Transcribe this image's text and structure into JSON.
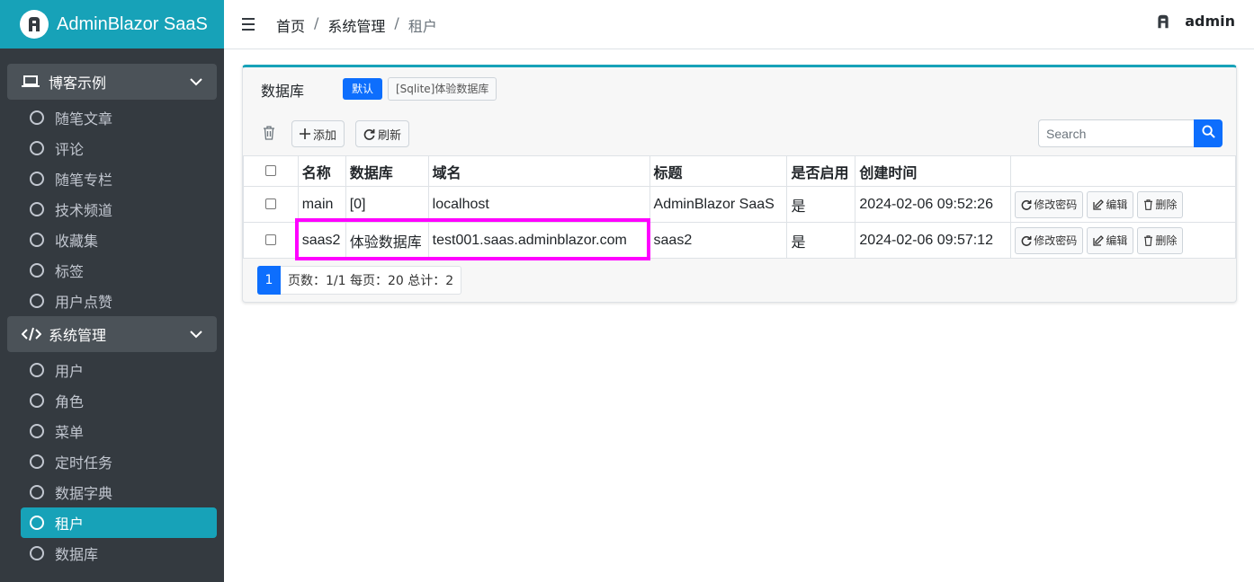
{
  "brand": {
    "title": "AdminBlazor SaaS",
    "logo_icon": "adminblazor-logo-icon"
  },
  "sidebar": {
    "groups": [
      {
        "label": "博客示例",
        "icon": "laptop-icon",
        "items": [
          "随笔文章",
          "评论",
          "随笔专栏",
          "技术频道",
          "收藏集",
          "标签",
          "用户点赞"
        ]
      },
      {
        "label": "系统管理",
        "icon": "code-icon",
        "items": [
          "用户",
          "角色",
          "菜单",
          "定时任务",
          "数据字典",
          "租户",
          "数据库"
        ]
      }
    ],
    "active_item": "租户"
  },
  "header": {
    "breadcrumb": [
      "首页",
      "系统管理",
      "租户"
    ],
    "user": "admin"
  },
  "card": {
    "db_label": "数据库",
    "db_default": "默认",
    "db_option": "[Sqlite]体验数据库",
    "toolbar": {
      "add": "添加",
      "refresh": "刷新"
    },
    "search_placeholder": "Search",
    "columns": [
      "名称",
      "数据库",
      "域名",
      "标题",
      "是否启用",
      "创建时间"
    ],
    "rows": [
      {
        "name": "main",
        "database": "[0]",
        "domain": "localhost",
        "title": "AdminBlazor SaaS",
        "enabled": "是",
        "created": "2024-02-06 09:52:26"
      },
      {
        "name": "saas2",
        "database": "体验数据库",
        "domain": "test001.saas.adminblazor.com",
        "title": "saas2",
        "enabled": "是",
        "created": "2024-02-06 09:57:12"
      }
    ],
    "row_actions": {
      "change_password": "修改密码",
      "edit": "编辑",
      "delete": "删除"
    },
    "pager": {
      "current": "1",
      "info": "页数：1/1 每页：20 总计：2"
    }
  },
  "colors": {
    "sidebar_bg": "#343a40",
    "accent": "#17a2b8",
    "primary": "#0d6efd",
    "highlight": "#ff00ff"
  }
}
